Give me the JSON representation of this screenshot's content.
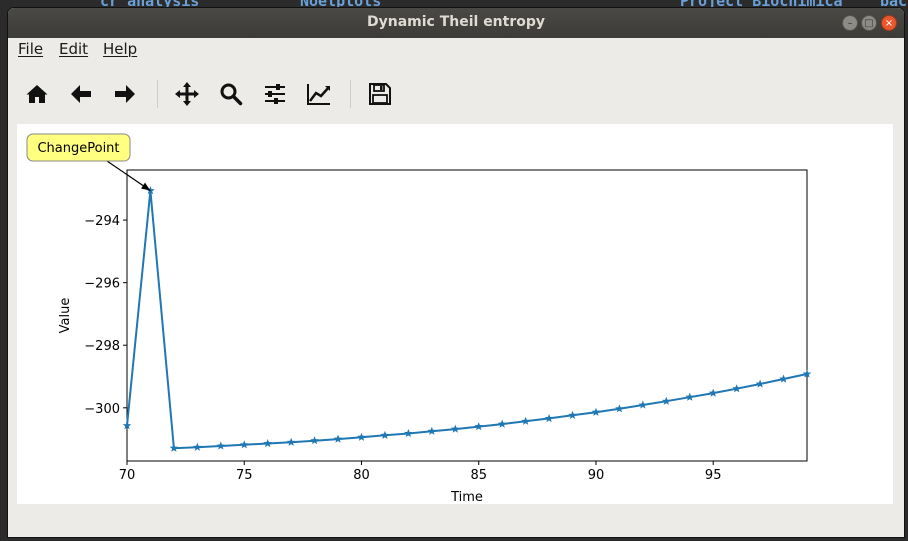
{
  "background": {
    "terminal_fragments": [
      "cr_analysis",
      "Noetplots",
      "Project_Biochimica",
      "bac"
    ]
  },
  "window": {
    "title": "Dynamic Theil entropy",
    "controls": [
      "minimize",
      "maximize",
      "close"
    ]
  },
  "menu": {
    "file": "File",
    "edit": "Edit",
    "help": "Help"
  },
  "toolbar": {
    "buttons": [
      {
        "icon": "home-icon"
      },
      {
        "icon": "back-arrow-icon"
      },
      {
        "icon": "forward-arrow-icon"
      },
      {
        "icon": "pan-move-icon"
      },
      {
        "icon": "zoom-magnifier-icon"
      },
      {
        "icon": "configure-subplots-icon"
      },
      {
        "icon": "edit-axis-line-icon"
      },
      {
        "icon": "save-floppy-icon"
      }
    ]
  },
  "chart_data": {
    "type": "line",
    "marker": "star",
    "color": "#1f77b4",
    "xlabel": "Time",
    "ylabel": "Value",
    "xlim": [
      70,
      99
    ],
    "ylim": [
      -301.7,
      -292.4
    ],
    "xticks": [
      70,
      75,
      80,
      85,
      90,
      95
    ],
    "xtick_labels": [
      "70",
      "75",
      "80",
      "85",
      "90",
      "95"
    ],
    "yticks": [
      -300,
      -298,
      -296,
      -294
    ],
    "ytick_labels": [
      "−300",
      "−298",
      "−296",
      "−294"
    ],
    "annotation": {
      "text": "ChangePoint",
      "x": 71,
      "y": -293.06
    },
    "x": [
      70,
      71,
      72,
      73,
      74,
      75,
      76,
      77,
      78,
      79,
      80,
      81,
      82,
      83,
      84,
      85,
      86,
      87,
      88,
      89,
      90,
      91,
      92,
      93,
      94,
      95,
      96,
      97,
      98,
      99
    ],
    "y": [
      -300.57,
      -293.06,
      -301.29,
      -301.26,
      -301.22,
      -301.18,
      -301.14,
      -301.1,
      -301.05,
      -301.0,
      -300.94,
      -300.88,
      -300.82,
      -300.75,
      -300.68,
      -300.6,
      -300.52,
      -300.43,
      -300.34,
      -300.24,
      -300.14,
      -300.03,
      -299.91,
      -299.79,
      -299.66,
      -299.53,
      -299.39,
      -299.24,
      -299.08,
      -298.92
    ]
  }
}
